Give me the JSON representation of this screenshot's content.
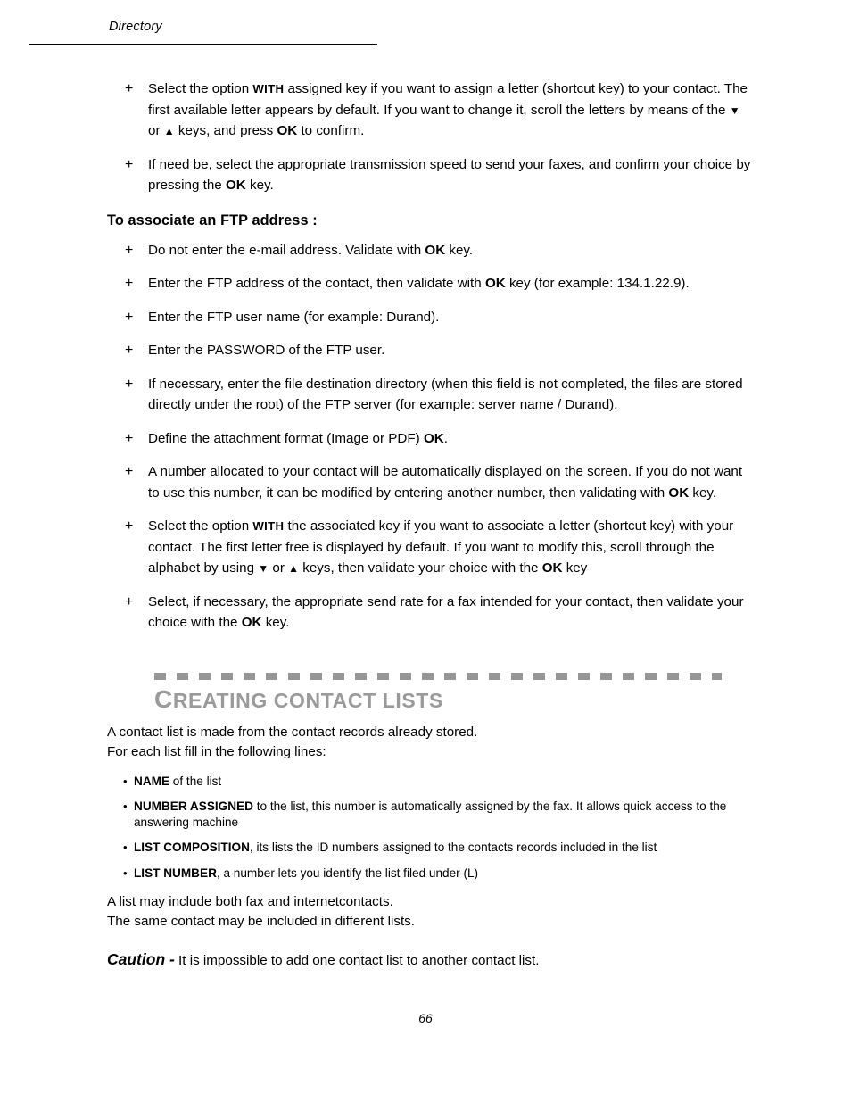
{
  "header": {
    "title": "Directory"
  },
  "body": {
    "bullets_top": [
      {
        "parts": [
          {
            "t": "Select the option ",
            "s": "n"
          },
          {
            "t": "WITH",
            "s": "sc"
          },
          {
            "t": " assigned key if you want to assign a letter (shortcut key) to your contact. The first available letter appears by default. If you want to change it, scroll the letters by means of the ",
            "s": "n"
          },
          {
            "t": "▼",
            "s": "tri"
          },
          {
            "t": " or ",
            "s": "n"
          },
          {
            "t": "▲",
            "s": "tri"
          },
          {
            "t": "  keys, and press ",
            "s": "n"
          },
          {
            "t": "OK",
            "s": "b"
          },
          {
            "t": " to confirm.",
            "s": "n"
          }
        ]
      },
      {
        "parts": [
          {
            "t": "If need be, select the appropriate transmission speed to send your faxes, and confirm your choice by pressing the ",
            "s": "n"
          },
          {
            "t": "OK",
            "s": "b"
          },
          {
            "t": " key.",
            "s": "n"
          }
        ]
      }
    ],
    "ftp_heading": "To associate an FTP address :",
    "bullets_ftp": [
      {
        "parts": [
          {
            "t": "Do not enter the e-mail address. Validate with ",
            "s": "n"
          },
          {
            "t": "OK",
            "s": "b"
          },
          {
            "t": " key.",
            "s": "n"
          }
        ]
      },
      {
        "parts": [
          {
            "t": "Enter the FTP address of the contact, then validate with ",
            "s": "n"
          },
          {
            "t": "OK",
            "s": "b"
          },
          {
            "t": " key (for example: 134.1.22.9).",
            "s": "n"
          }
        ]
      },
      {
        "parts": [
          {
            "t": "Enter the FTP user name (for example: Durand).",
            "s": "n"
          }
        ]
      },
      {
        "parts": [
          {
            "t": "Enter the PASSWORD of the FTP user.",
            "s": "n"
          }
        ]
      },
      {
        "parts": [
          {
            "t": "If necessary, enter the file destination directory (when this field is not completed, the files are stored directly under the root) of the FTP server  (for example: server name / Durand).",
            "s": "n"
          }
        ]
      },
      {
        "parts": [
          {
            "t": "Define the attachment format (Image or PDF) ",
            "s": "n"
          },
          {
            "t": "OK",
            "s": "b"
          },
          {
            "t": ".",
            "s": "n"
          }
        ]
      },
      {
        "parts": [
          {
            "t": "A number allocated to your contact will be automatically displayed on the screen.  If you do not want to use this number, it can be modified by entering another number, then validating with ",
            "s": "n"
          },
          {
            "t": "OK",
            "s": "b"
          },
          {
            "t": " key.",
            "s": "n"
          }
        ]
      },
      {
        "parts": [
          {
            "t": "Select the option ",
            "s": "n"
          },
          {
            "t": "WITH",
            "s": "sc"
          },
          {
            "t": "  the associated key if you want to associate a letter (shortcut key) with your contact.  The first letter free is displayed by default.  If you want to modify this, scroll through the alphabet by using ",
            "s": "n"
          },
          {
            "t": "▼",
            "s": "tri"
          },
          {
            "t": " or ",
            "s": "n"
          },
          {
            "t": "▲",
            "s": "tri"
          },
          {
            "t": "  keys, then validate your choice with the ",
            "s": "n"
          },
          {
            "t": "OK",
            "s": "b"
          },
          {
            "t": " key",
            "s": "n"
          }
        ]
      },
      {
        "parts": [
          {
            "t": "Select, if necessary, the appropriate send rate for a fax intended for your contact, then validate your choice with the ",
            "s": "n"
          },
          {
            "t": "OK",
            "s": "b"
          },
          {
            "t": " key.",
            "s": "n"
          }
        ]
      }
    ]
  },
  "chapter": {
    "title_initial": "C",
    "title_rest": "REATING CONTACT LISTS"
  },
  "lower": {
    "intro_line_1": "A contact list is made from the contact records already stored.",
    "intro_line_2": "For each list fill in the following lines:",
    "bullets": [
      {
        "parts": [
          {
            "t": "NAME",
            "s": "b"
          },
          {
            "t": " of the list",
            "s": "n"
          }
        ]
      },
      {
        "parts": [
          {
            "t": "NUMBER ASSIGNED",
            "s": "b"
          },
          {
            "t": " to the list, this number is automatically assigned by the fax. It allows quick access to the answering machine",
            "s": "n"
          }
        ]
      },
      {
        "parts": [
          {
            "t": "LIST COMPOSITION",
            "s": "b"
          },
          {
            "t": ", its lists the ID numbers assigned to the contacts records included in the list",
            "s": "n"
          }
        ]
      },
      {
        "parts": [
          {
            "t": "LIST NUMBER",
            "s": "b"
          },
          {
            "t": ", a number lets you identify the list filed under (L)",
            "s": "n"
          }
        ]
      }
    ],
    "tail_line_1": "A list may include both fax and internetcontacts.",
    "tail_line_2": "The same contact may be included in different lists.",
    "caution_label": "Caution -",
    "caution_text": " It is impossible to add one contact list to another contact list."
  },
  "footer": {
    "page_number": "66"
  }
}
